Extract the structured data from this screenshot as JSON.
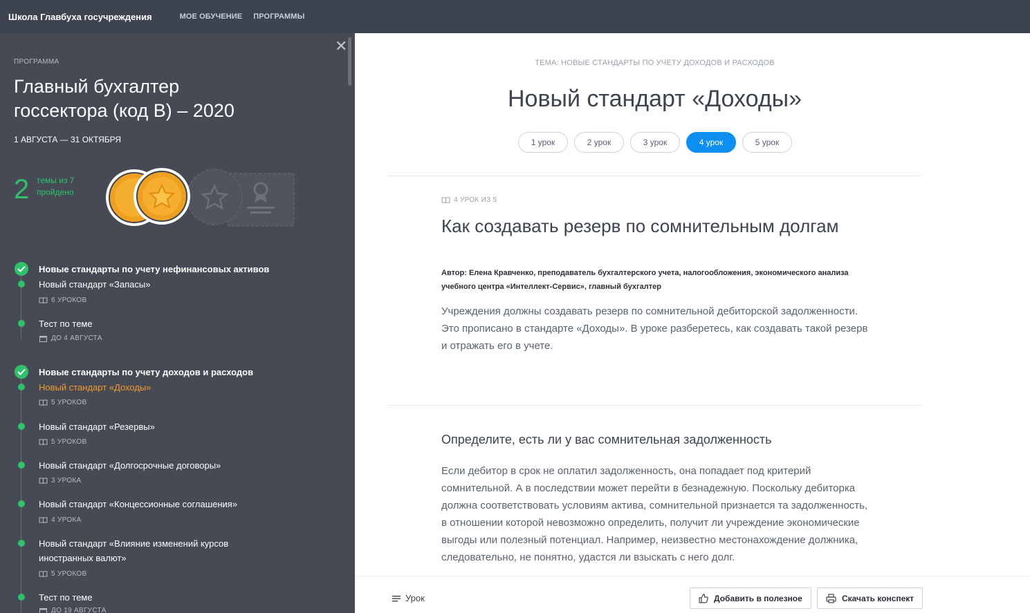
{
  "header": {
    "brand": "Школа Главбуха госучреждения",
    "nav": [
      "МОЕ ОБУЧЕНИЕ",
      "ПРОГРАММЫ"
    ]
  },
  "sidebar": {
    "program_label": "ПРОГРАММА",
    "program_title": "Главный бухгалтер госсектора (код В) – 2020",
    "dates": "1 АВГУСТА — 31 ОКТЯБРЯ",
    "progress": {
      "count": "2",
      "text": "темы из 7 пройдено",
      "completed": 2,
      "total": 7
    },
    "groups": [
      {
        "title": "Новые стандарты по учету нефинансовых активов",
        "items": [
          {
            "title": "Новый стандарт «Запасы»",
            "meta": "6 УРОКОВ",
            "meta_icon": "book-icon"
          },
          {
            "title": "Тест по теме",
            "meta": "ДО 4 АВГУСТА",
            "meta_icon": "calendar-icon"
          }
        ]
      },
      {
        "title": "Новые стандарты по учету доходов и расходов",
        "items": [
          {
            "title": "Новый стандарт «Доходы»",
            "meta": "5 УРОКОВ",
            "meta_icon": "book-icon"
          },
          {
            "title": "Новый стандарт «Резервы»",
            "meta": "5 УРОКОВ",
            "meta_icon": "book-icon"
          },
          {
            "title": "Новый стандарт «Долгосрочные договоры»",
            "meta": "3 УРОКА",
            "meta_icon": "book-icon"
          },
          {
            "title": "Новый стандарт «Концессионные соглашения»",
            "meta": "4 УРОКА",
            "meta_icon": "book-icon"
          },
          {
            "title": "Новый стандарт «Влияние изменений курсов иностранных валют»",
            "meta": "5 УРОКОВ",
            "meta_icon": "book-icon"
          },
          {
            "title": "Тест по теме",
            "meta": "ДО 19 АВГУСТА",
            "meta_icon": "calendar-icon"
          }
        ]
      }
    ]
  },
  "main": {
    "topic": "ТЕМА: НОВЫЕ СТАНДАРТЫ ПО УЧЕТУ ДОХОДОВ И РАСХОДОВ",
    "title": "Новый стандарт «Доходы»",
    "lessons": [
      "1 урок",
      "2 урок",
      "3 урок",
      "4 урок",
      "5 урок"
    ],
    "active_lesson": "4 урок",
    "lesson_of": "4 УРОК ИЗ 5",
    "lesson_title": "Как создавать резерв по сомнительным долгам",
    "author": "Автор: Елена Кравченко, преподаватель бухгалтерского учета, налогообложения, экономического анализа учебного центра «Интеллект-Сервис», главный бухгалтер",
    "intro": "Учреждения должны создавать резерв по сомнительной дебиторской задолженности. Это прописано в стандарте «Доходы». В уроке разберетесь, как создавать такой резерв и отражать его в учете.",
    "section_title": "Определите, есть ли у вас сомнительная задолженность",
    "section_text": "Если дебитор в срок не оплатил задолженность, она попадает под критерий сомнительной. А в последствии может перейти в безнадежную. Поскольку дебиторка должна соответствовать условиям актива, сомнительной признается та задолженность, в отношении которой невозможно определить, получит ли учреждение экономические выгоды или полезный потенциал. Например, неизвестно местонахождение должника, следовательно, не понятно, удастся ли взыскать с него долг."
  },
  "bottombar": {
    "lesson_label": "Урок",
    "add_favorite": "Добавить в полезное",
    "download": "Скачать конспект"
  },
  "colors": {
    "topbar": "#3d4450",
    "sidebar": "#454a54",
    "success": "#2fc26b",
    "active_item": "#f59a2b",
    "accent": "#0d8ff2"
  }
}
